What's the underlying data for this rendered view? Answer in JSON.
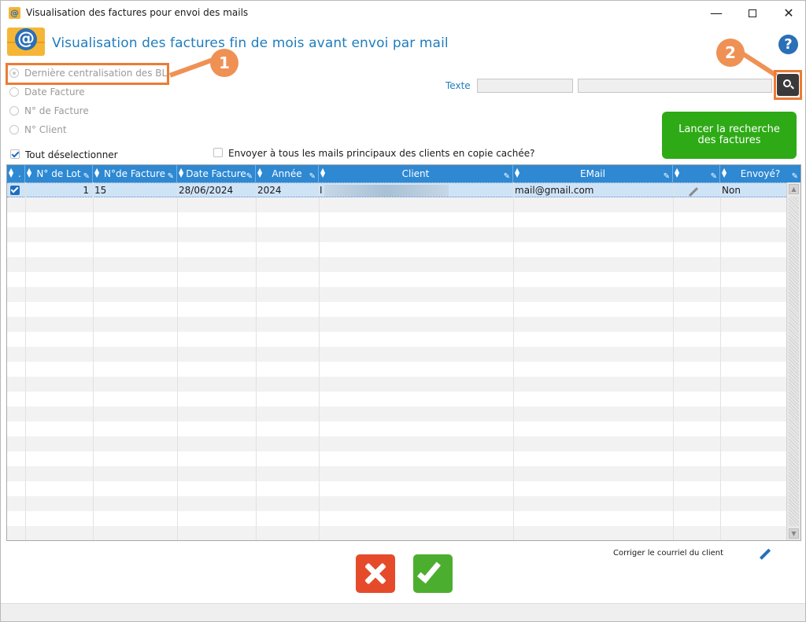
{
  "window": {
    "title": "Visualisation des factures pour envoi des mails",
    "app_icon": "@",
    "min_glyph": "—",
    "close_glyph": "✕"
  },
  "header": {
    "title": "Visualisation des factures fin de mois avant envoi par mail",
    "help_glyph": "?"
  },
  "filters": {
    "options": [
      {
        "label": "Dernière centralisation des BL",
        "checked": true
      },
      {
        "label": "Date Facture",
        "checked": false
      },
      {
        "label": "N° de Facture",
        "checked": false
      },
      {
        "label": "N° Client",
        "checked": false
      }
    ]
  },
  "search": {
    "label": "Texte",
    "value1": "",
    "value2": ""
  },
  "launch_button": "Lancer la recherche des factures",
  "options": {
    "deselect_all": "Tout déselectionner",
    "deselect_all_checked": true,
    "bcc_all": "Envoyer à tous les mails principaux des clients en copie cachée?",
    "bcc_all_checked": false
  },
  "annotations": {
    "badge1": "1",
    "badge2": "2"
  },
  "grid": {
    "columns": [
      {
        "key": "sel",
        "label": "."
      },
      {
        "key": "lot",
        "label": "N° de Lot"
      },
      {
        "key": "facture",
        "label": "N°de Facture"
      },
      {
        "key": "date",
        "label": "Date Facture"
      },
      {
        "key": "annee",
        "label": "Année"
      },
      {
        "key": "client",
        "label": "Client"
      },
      {
        "key": "email",
        "label": "EMail"
      },
      {
        "key": "edit",
        "label": ""
      },
      {
        "key": "envoye",
        "label": "Envoyé?"
      }
    ],
    "rows": [
      {
        "lot": "1",
        "facture": "15",
        "date": "28/06/2024",
        "annee": "2024",
        "client": "I",
        "email": "mail@gmail.com",
        "envoye": "Non"
      }
    ],
    "scroll_up": "▲",
    "scroll_down": "▼"
  },
  "footer": {
    "corriger": "Corriger le courriel du client"
  },
  "colors": {
    "accent": "#2e88d2",
    "title": "#1f7dbd",
    "launch": "#2eaa16",
    "callout": "#ec7b35",
    "cancel": "#e54b2a",
    "ok": "#4cae2f"
  }
}
